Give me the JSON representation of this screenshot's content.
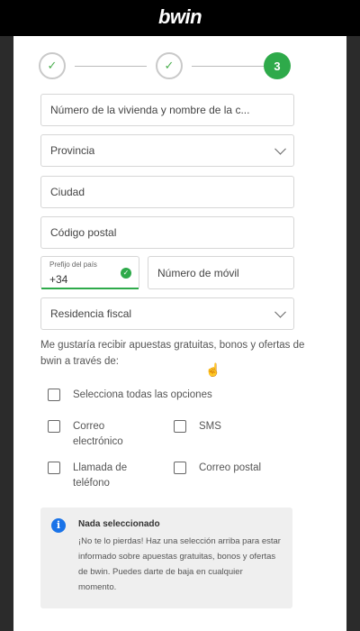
{
  "brand": {
    "logo": "bwin"
  },
  "stepper": {
    "steps": [
      {
        "state": "done",
        "glyph": "✓"
      },
      {
        "state": "done",
        "glyph": "✓"
      },
      {
        "state": "active",
        "glyph": "3"
      }
    ]
  },
  "form": {
    "address_placeholder": "Número de la vivienda y nombre de la c...",
    "province_placeholder": "Provincia",
    "city_placeholder": "Ciudad",
    "postal_placeholder": "Código postal",
    "prefix_label": "Prefijo del país",
    "prefix_value": "+34",
    "mobile_placeholder": "Número de móvil",
    "tax_residence_placeholder": "Residencia fiscal"
  },
  "marketing": {
    "intro": "Me gustaría recibir apuestas gratuitas, bonos y ofertas de bwin a través de:",
    "select_all": "Selecciona todas las opciones",
    "email": "Correo electrónico",
    "sms": "SMS",
    "phone": "Llamada de teléfono",
    "post": "Correo postal"
  },
  "notice": {
    "icon": "info-icon",
    "title": "Nada seleccionado",
    "body": "¡No te lo pierdas! Haz una selección arriba para estar informado sobre apuestas gratuitas, bonos y ofertas de bwin. Puedes darte de baja en cualquier momento."
  },
  "colors": {
    "accent_green": "#2eaa4a",
    "info_blue": "#1a73e8",
    "header_bg": "#000000"
  }
}
